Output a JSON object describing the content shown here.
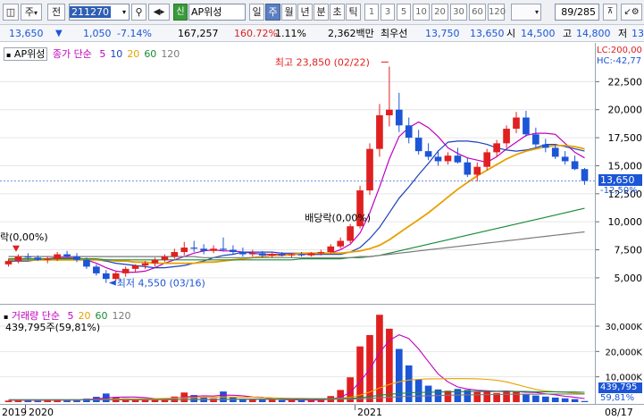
{
  "toolbar": {
    "market_button": "주",
    "prev_label": "전",
    "code_value": "211270",
    "new_label": "신",
    "name_value": "AP위성",
    "period_buttons": [
      "일",
      "주",
      "월",
      "년",
      "분",
      "초",
      "틱"
    ],
    "active_period": "주",
    "interval_buttons": [
      "1",
      "3",
      "5",
      "10",
      "20",
      "30",
      "60",
      "120"
    ],
    "page_counter": "89/285"
  },
  "infobar": {
    "price": "13,650",
    "change": "1,050",
    "change_pct": "-7.14%",
    "volume": "167,257",
    "volume_ratio": "160.72%",
    "turnover_rate": "1.11%",
    "trade_amount": "2,362백만",
    "best_ask_label": "최우선",
    "best_ask": "13,750",
    "best_bid": "13,650",
    "open_label": "시",
    "open": "14,500",
    "high_label": "고",
    "high": "14,800",
    "low_label": "저",
    "low": "13"
  },
  "price_panel": {
    "title": "AP위성",
    "ma_label": "종가 단순",
    "ma_periods": [
      "5",
      "10",
      "20",
      "60",
      "120"
    ],
    "ma_colors": [
      "#c000c0",
      "#1a3fbf",
      "#e8a000",
      "#1a8a3a",
      "#7a7a7a"
    ],
    "lc_label": "LC:200,00",
    "hc_label": "HC:-42,77",
    "annotation_high": "최고 23,850 (02/22)",
    "annotation_low": "최저 4,550 (03/16)",
    "annotation_dividend": "배당락(0,00%)",
    "annotation_left": "락(0,00%)",
    "current_price": "13,650",
    "current_pct": "-12,50%",
    "y_ticks": [
      "22,500",
      "20,000",
      "17,500",
      "15,000",
      "12,500",
      "10,000",
      "7,500",
      "5,000"
    ]
  },
  "volume_panel": {
    "title": "거래량",
    "ma_label": "단순",
    "ma_periods": [
      "5",
      "20",
      "60",
      "120"
    ],
    "current_volume": "439,795주(59,81%)",
    "current_value": "439,795",
    "current_pct": "59,81%",
    "y_ticks": [
      "30,000K",
      "20,000K",
      "10,000K"
    ]
  },
  "x_axis": {
    "labels": [
      "2019",
      "2020",
      "2021",
      "08/17"
    ]
  },
  "chart_data": {
    "type": "candlestick",
    "price_range": [
      3000,
      25000
    ],
    "volume_range": [
      0,
      36000
    ],
    "candles": [
      [
        6200,
        6700,
        6000,
        6500
      ],
      [
        6500,
        7100,
        6300,
        6900
      ],
      [
        6900,
        7200,
        6600,
        6800
      ],
      [
        6800,
        7000,
        6500,
        6600
      ],
      [
        6600,
        6900,
        6300,
        6700
      ],
      [
        6700,
        7300,
        6500,
        7100
      ],
      [
        7100,
        7400,
        6800,
        6900
      ],
      [
        6900,
        7200,
        6400,
        6600
      ],
      [
        6600,
        6800,
        5800,
        6000
      ],
      [
        6000,
        6200,
        5200,
        5400
      ],
      [
        5400,
        5700,
        4550,
        4900
      ],
      [
        4900,
        5600,
        4700,
        5400
      ],
      [
        5400,
        6000,
        5100,
        5800
      ],
      [
        5800,
        6200,
        5500,
        6100
      ],
      [
        6100,
        6500,
        5800,
        6300
      ],
      [
        6300,
        6800,
        6000,
        6600
      ],
      [
        6600,
        7100,
        6400,
        6900
      ],
      [
        6900,
        7600,
        6700,
        7300
      ],
      [
        7300,
        8200,
        7000,
        7700
      ],
      [
        7700,
        8300,
        7300,
        7600
      ],
      [
        7600,
        8000,
        7100,
        7400
      ],
      [
        7400,
        7900,
        7200,
        7600
      ],
      [
        7600,
        8600,
        7400,
        7500
      ],
      [
        7500,
        7900,
        7100,
        7300
      ],
      [
        7300,
        7700,
        6900,
        7100
      ],
      [
        7100,
        7500,
        6900,
        7200
      ],
      [
        7200,
        7400,
        6800,
        7000
      ],
      [
        7000,
        7300,
        6800,
        7100
      ],
      [
        7100,
        7300,
        6900,
        7000
      ],
      [
        7000,
        7200,
        6800,
        7100
      ],
      [
        7100,
        7300,
        6900,
        7000
      ],
      [
        7000,
        7300,
        6900,
        7200
      ],
      [
        7200,
        7500,
        7000,
        7300
      ],
      [
        7300,
        8000,
        7200,
        7800
      ],
      [
        7800,
        8600,
        7600,
        8300
      ],
      [
        8300,
        9800,
        8100,
        9600
      ],
      [
        9600,
        13200,
        9400,
        12800
      ],
      [
        12800,
        17000,
        12400,
        16500
      ],
      [
        16500,
        20500,
        15800,
        19500
      ],
      [
        19500,
        23850,
        18500,
        20000
      ],
      [
        20000,
        21500,
        18000,
        18600
      ],
      [
        18600,
        19300,
        17000,
        17500
      ],
      [
        17500,
        18200,
        16000,
        16300
      ],
      [
        16300,
        17000,
        15500,
        15800
      ],
      [
        15800,
        16400,
        15000,
        15400
      ],
      [
        15400,
        16200,
        15100,
        15900
      ],
      [
        15900,
        16600,
        15200,
        15300
      ],
      [
        15300,
        15700,
        14000,
        14200
      ],
      [
        14200,
        15300,
        13600,
        14900
      ],
      [
        14900,
        16500,
        14600,
        16200
      ],
      [
        16200,
        17300,
        15800,
        17000
      ],
      [
        17000,
        18600,
        16600,
        18300
      ],
      [
        18300,
        19800,
        17900,
        19300
      ],
      [
        19300,
        19900,
        17600,
        17800
      ],
      [
        17800,
        18400,
        16600,
        16900
      ],
      [
        16900,
        17400,
        16200,
        16600
      ],
      [
        16600,
        16900,
        15600,
        15800
      ],
      [
        15800,
        16300,
        15100,
        15400
      ],
      [
        15400,
        15900,
        14600,
        14700
      ],
      [
        14700,
        14800,
        13300,
        13650
      ]
    ],
    "volumes": [
      600,
      900,
      700,
      500,
      600,
      1100,
      800,
      900,
      1400,
      2100,
      3400,
      1800,
      1500,
      1200,
      1000,
      1300,
      1600,
      2200,
      3800,
      2800,
      1900,
      1500,
      4200,
      2000,
      1400,
      1200,
      1000,
      900,
      800,
      900,
      700,
      900,
      1000,
      2400,
      4800,
      9800,
      22000,
      26500,
      34500,
      29000,
      21000,
      14500,
      9000,
      6500,
      5000,
      4500,
      5200,
      4800,
      4000,
      4200,
      3600,
      4400,
      4200,
      3200,
      2600,
      2200,
      1800,
      1500,
      1200,
      440
    ],
    "series": [
      {
        "name": "5",
        "values": [
          6400,
          6600,
          6700,
          6700,
          6700,
          6800,
          6800,
          6800,
          6600,
          6300,
          5900,
          5600,
          5500,
          5500,
          5600,
          5900,
          6300,
          6600,
          6900,
          7200,
          7400,
          7500,
          7400,
          7400,
          7300,
          7200,
          7100,
          7100,
          7100,
          7100,
          7100,
          7100,
          7100,
          7200,
          7500,
          8000,
          9000,
          10800,
          13100,
          15600,
          17600,
          18400,
          18900,
          18400,
          17600,
          16600,
          16100,
          15700,
          15500,
          15300,
          15800,
          16500,
          17100,
          17700,
          17900,
          17900,
          17800,
          17000,
          16200,
          15700
        ]
      },
      {
        "name": "10",
        "values": [
          6500,
          6500,
          6500,
          6600,
          6600,
          6600,
          6700,
          6700,
          6700,
          6600,
          6500,
          6300,
          6200,
          6100,
          6000,
          5900,
          5900,
          6000,
          6100,
          6300,
          6500,
          6800,
          7000,
          7100,
          7300,
          7300,
          7300,
          7300,
          7200,
          7200,
          7200,
          7100,
          7100,
          7100,
          7100,
          7300,
          7700,
          8500,
          9500,
          10800,
          12100,
          13100,
          14200,
          15200,
          16300,
          17100,
          17200,
          17200,
          17100,
          16900,
          16600,
          16400,
          16300,
          16400,
          16600,
          16900,
          16900,
          16700,
          16500,
          16300
        ]
      },
      {
        "name": "20",
        "values": [
          6600,
          6600,
          6600,
          6600,
          6600,
          6600,
          6600,
          6600,
          6600,
          6600,
          6600,
          6500,
          6500,
          6400,
          6400,
          6300,
          6300,
          6300,
          6300,
          6300,
          6400,
          6400,
          6500,
          6600,
          6700,
          6800,
          6900,
          7000,
          7000,
          7100,
          7200,
          7200,
          7200,
          7200,
          7200,
          7300,
          7400,
          7600,
          7900,
          8400,
          9000,
          9600,
          10200,
          10800,
          11500,
          12200,
          12900,
          13500,
          14100,
          14600,
          15100,
          15600,
          16000,
          16300,
          16500,
          16700,
          16800,
          16800,
          16700,
          16500
        ]
      },
      {
        "name": "60",
        "values": [
          6700,
          6700,
          6700,
          6700,
          6700,
          6700,
          6700,
          6700,
          6700,
          6700,
          6600,
          6600,
          6600,
          6600,
          6600,
          6600,
          6600,
          6600,
          6600,
          6600,
          6600,
          6600,
          6600,
          6600,
          6600,
          6600,
          6600,
          6600,
          6600,
          6600,
          6700,
          6700,
          6700,
          6700,
          6700,
          6800,
          6800,
          6900,
          7000,
          7200,
          7400,
          7600,
          7800,
          8000,
          8200,
          8400,
          8600,
          8800,
          9000,
          9200,
          9400,
          9600,
          9800,
          10000,
          10200,
          10400,
          10600,
          10800,
          11000,
          11200
        ]
      },
      {
        "name": "120",
        "values": [
          6900,
          6900,
          6900,
          6900,
          6900,
          6900,
          6900,
          6900,
          6900,
          6900,
          6900,
          6900,
          6900,
          6900,
          6900,
          6900,
          6900,
          6900,
          6900,
          6900,
          6800,
          6800,
          6800,
          6800,
          6800,
          6800,
          6800,
          6800,
          6800,
          6800,
          6800,
          6800,
          6800,
          6800,
          6800,
          6800,
          6900,
          6900,
          7000,
          7100,
          7200,
          7300,
          7400,
          7500,
          7600,
          7700,
          7800,
          7900,
          8000,
          8100,
          8200,
          8300,
          8400,
          8500,
          8600,
          8700,
          8800,
          8900,
          9000,
          9100
        ]
      }
    ],
    "volume_ma": [
      {
        "name": "5",
        "values": [
          700,
          700,
          700,
          700,
          700,
          700,
          800,
          800,
          1000,
          1300,
          1700,
          1900,
          2000,
          2000,
          1800,
          1400,
          1300,
          1500,
          2000,
          2300,
          2500,
          2400,
          2800,
          2700,
          2500,
          2000,
          1900,
          1300,
          1000,
          900,
          900,
          800,
          800,
          1200,
          1900,
          3800,
          8100,
          13000,
          19500,
          24400,
          26600,
          25100,
          21000,
          16000,
          11100,
          8000,
          6000,
          5200,
          4700,
          4500,
          4300,
          4400,
          4200,
          3900,
          3800,
          3300,
          2900,
          2300,
          1900,
          1400
        ]
      },
      {
        "name": "20",
        "values": [
          800,
          800,
          800,
          800,
          800,
          800,
          800,
          800,
          900,
          1000,
          1100,
          1200,
          1200,
          1300,
          1300,
          1400,
          1500,
          1600,
          1700,
          1800,
          1900,
          1900,
          2000,
          2000,
          1900,
          1900,
          1800,
          1700,
          1600,
          1500,
          1500,
          1400,
          1400,
          1400,
          1600,
          1900,
          2800,
          4000,
          5600,
          7000,
          8000,
          8700,
          9000,
          9200,
          9200,
          9300,
          9300,
          9300,
          9200,
          9000,
          8600,
          8000,
          7000,
          6000,
          5000,
          4400,
          4100,
          3900,
          3600,
          3300
        ]
      },
      {
        "name": "60",
        "values": [
          900,
          900,
          900,
          900,
          900,
          900,
          900,
          900,
          900,
          900,
          900,
          900,
          900,
          900,
          1000,
          1000,
          1000,
          1000,
          1000,
          1100,
          1100,
          1100,
          1100,
          1200,
          1200,
          1200,
          1200,
          1200,
          1300,
          1300,
          1300,
          1300,
          1300,
          1300,
          1400,
          1500,
          1800,
          2200,
          2700,
          3100,
          3400,
          3700,
          3800,
          3900,
          4000,
          4100,
          4100,
          4200,
          4200,
          4200,
          4200,
          4200,
          4200,
          4200,
          4100,
          4100,
          4100,
          4000,
          4000,
          3900
        ]
      },
      {
        "name": "120",
        "values": [
          1000,
          1000,
          1000,
          1000,
          1000,
          1000,
          1000,
          1000,
          1000,
          1000,
          1000,
          1000,
          1000,
          1000,
          1000,
          1000,
          1000,
          1000,
          1000,
          1000,
          1000,
          1000,
          1000,
          1100,
          1100,
          1100,
          1100,
          1100,
          1100,
          1100,
          1100,
          1100,
          1100,
          1100,
          1200,
          1200,
          1300,
          1500,
          1700,
          1900,
          2100,
          2300,
          2400,
          2500,
          2600,
          2700,
          2800,
          2900,
          2900,
          3000,
          3000,
          3100,
          3100,
          3100,
          3100,
          3200,
          3200,
          3200,
          3200,
          3200
        ]
      }
    ],
    "up_color": "#e02020",
    "down_color": "#1c55d6"
  }
}
